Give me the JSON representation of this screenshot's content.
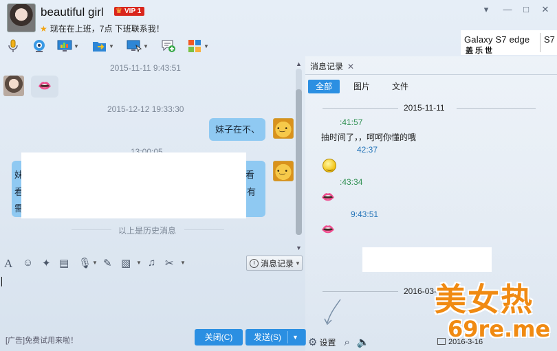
{
  "contact": {
    "name": "beautiful girl",
    "vip": "VIP 1",
    "status": "现在在上班，7点 下班联系我！"
  },
  "window_controls": [
    "▾",
    "—",
    "□",
    "✕"
  ],
  "toolbar_icons": [
    "microphone-icon",
    "video-call-icon",
    "screen-share-icon",
    "file-transfer-icon",
    "remote-desktop-icon",
    "add-chat-icon",
    "apps-icon"
  ],
  "ad": {
    "line1": "Galaxy S7 edge",
    "line2": "盖乐世",
    "line3": "S7"
  },
  "chat": {
    "ts1": "2015-11-11 9:43:51",
    "ts2": "2015-12-12 19:33:30",
    "ts3": "13:00:05",
    "msg_right": "妹子在不、",
    "frag_left": [
      "妹",
      "看",
      "需"
    ],
    "frag_right": [
      "看",
      "有"
    ],
    "history_divider": "以上是历史消息"
  },
  "input_toolbar": {
    "icons": [
      "font-icon",
      "emoji-icon",
      "magic-icon",
      "video-clip-icon",
      "voice-icon",
      "edit-icon",
      "image-icon",
      "music-icon",
      "screenshot-icon"
    ],
    "history_button": "消息记录"
  },
  "footer": {
    "ad": "[广告]免费试用来啦！",
    "close": "关闭(C)",
    "send": "发送(S)"
  },
  "history": {
    "tab": "消息记录",
    "filters": [
      "全部",
      "图片",
      "文件"
    ],
    "date1": "2015-11-11",
    "t1": ":41:57",
    "text1": "抽时间了，，呵呵你懂的哦",
    "t2": "42:37",
    "t3": ":43:34",
    "t4": "9:43:51",
    "date2": "2016-03-1",
    "settings": "设置",
    "bottom_date": "2016-3-16"
  },
  "watermark": {
    "line1": "美女热",
    "line2": "69re.me"
  }
}
